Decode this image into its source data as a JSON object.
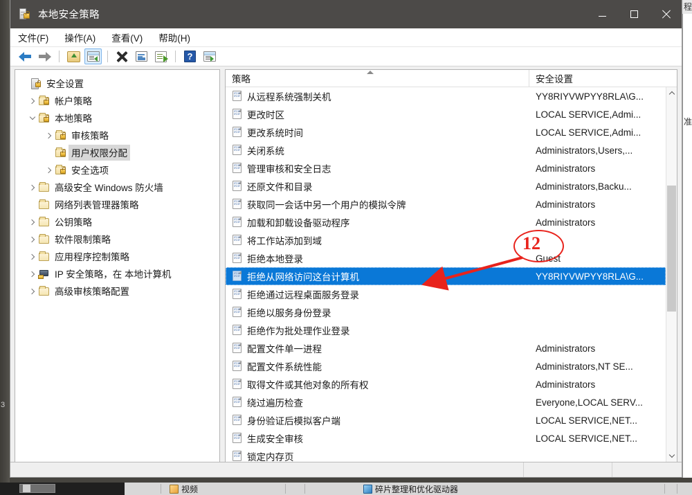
{
  "window": {
    "title": "本地安全策略",
    "icon": "security-policy-icon",
    "minimize_label": "最小化",
    "maximize_label": "最大化",
    "close_label": "关闭"
  },
  "menu": {
    "items": [
      {
        "label": "文件(F)"
      },
      {
        "label": "操作(A)"
      },
      {
        "label": "查看(V)"
      },
      {
        "label": "帮助(H)"
      }
    ]
  },
  "toolbar": {
    "buttons": [
      {
        "name": "back-arrow-icon",
        "label": "后退"
      },
      {
        "name": "forward-arrow-icon",
        "label": "前进"
      },
      {
        "name": "up-folder-icon",
        "label": "上一级"
      },
      {
        "name": "show-tree-icon",
        "label": "显示/隐藏控制台树"
      },
      {
        "name": "delete-icon",
        "label": "删除"
      },
      {
        "name": "properties-icon",
        "label": "属性"
      },
      {
        "name": "export-list-icon",
        "label": "导出列表"
      },
      {
        "name": "help-icon",
        "label": "?"
      },
      {
        "name": "window-icon",
        "label": "窗口"
      }
    ],
    "help_glyph": "?"
  },
  "tree": {
    "nodes": [
      {
        "label": "安全设置",
        "depth": 0,
        "expander": "none",
        "icon": "server-lock-icon",
        "selected": false
      },
      {
        "label": "帐户策略",
        "depth": 1,
        "expander": "closed",
        "icon": "folder-lock-icon",
        "selected": false
      },
      {
        "label": "本地策略",
        "depth": 1,
        "expander": "open",
        "icon": "folder-lock-icon",
        "selected": false
      },
      {
        "label": "审核策略",
        "depth": 2,
        "expander": "closed",
        "icon": "folder-lock-icon",
        "selected": false
      },
      {
        "label": "用户权限分配",
        "depth": 2,
        "expander": "none",
        "icon": "folder-lock-icon",
        "selected": true
      },
      {
        "label": "安全选项",
        "depth": 2,
        "expander": "closed",
        "icon": "folder-lock-icon",
        "selected": false
      },
      {
        "label": "高级安全 Windows 防火墙",
        "depth": 1,
        "expander": "closed",
        "icon": "folder-icon",
        "selected": false
      },
      {
        "label": "网络列表管理器策略",
        "depth": 1,
        "expander": "none",
        "icon": "folder-icon",
        "selected": false
      },
      {
        "label": "公钥策略",
        "depth": 1,
        "expander": "closed",
        "icon": "folder-icon",
        "selected": false
      },
      {
        "label": "软件限制策略",
        "depth": 1,
        "expander": "closed",
        "icon": "folder-icon",
        "selected": false
      },
      {
        "label": "应用程序控制策略",
        "depth": 1,
        "expander": "closed",
        "icon": "folder-icon",
        "selected": false
      },
      {
        "label": "IP 安全策略，在 本地计算机",
        "depth": 1,
        "expander": "closed",
        "icon": "network-policy-icon",
        "selected": false
      },
      {
        "label": "高级审核策略配置",
        "depth": 1,
        "expander": "closed",
        "icon": "folder-icon",
        "selected": false
      }
    ]
  },
  "list": {
    "columns": [
      {
        "label": "策略",
        "sort": "asc"
      },
      {
        "label": "安全设置",
        "sort": "none"
      }
    ],
    "rows": [
      {
        "policy": "从远程系统强制关机",
        "setting": "YY8RIYVWPYY8RLA\\G...",
        "selected": false
      },
      {
        "policy": "更改时区",
        "setting": "LOCAL SERVICE,Admi...",
        "selected": false
      },
      {
        "policy": "更改系统时间",
        "setting": "LOCAL SERVICE,Admi...",
        "selected": false
      },
      {
        "policy": "关闭系统",
        "setting": "Administrators,Users,...",
        "selected": false
      },
      {
        "policy": "管理审核和安全日志",
        "setting": "Administrators",
        "selected": false
      },
      {
        "policy": "还原文件和目录",
        "setting": "Administrators,Backu...",
        "selected": false
      },
      {
        "policy": "获取同一会话中另一个用户的模拟令牌",
        "setting": "Administrators",
        "selected": false
      },
      {
        "policy": "加载和卸载设备驱动程序",
        "setting": "Administrators",
        "selected": false
      },
      {
        "policy": "将工作站添加到域",
        "setting": "",
        "selected": false
      },
      {
        "policy": "拒绝本地登录",
        "setting": "Guest",
        "selected": false
      },
      {
        "policy": "拒绝从网络访问这台计算机",
        "setting": "YY8RIYVWPYY8RLA\\G...",
        "selected": true
      },
      {
        "policy": "拒绝通过远程桌面服务登录",
        "setting": "",
        "selected": false
      },
      {
        "policy": "拒绝以服务身份登录",
        "setting": "",
        "selected": false
      },
      {
        "policy": "拒绝作为批处理作业登录",
        "setting": "",
        "selected": false
      },
      {
        "policy": "配置文件单一进程",
        "setting": "Administrators",
        "selected": false
      },
      {
        "policy": "配置文件系统性能",
        "setting": "Administrators,NT SE...",
        "selected": false
      },
      {
        "policy": "取得文件或其他对象的所有权",
        "setting": "Administrators",
        "selected": false
      },
      {
        "policy": "绕过遍历检查",
        "setting": "Everyone,LOCAL SERV...",
        "selected": false
      },
      {
        "policy": "身份验证后模拟客户端",
        "setting": "LOCAL SERVICE,NET...",
        "selected": false
      },
      {
        "policy": "生成安全审核",
        "setting": "LOCAL SERVICE,NET...",
        "selected": false
      },
      {
        "policy": "锁定内存页",
        "setting": "",
        "selected": false
      }
    ]
  },
  "annotation": {
    "number": "12",
    "color": "#e8231c",
    "shape": "ellipse-with-arrow",
    "points_to": "拒绝从网络访问这台计算机"
  },
  "background": {
    "right_window_glyph": "准",
    "left_desktop_glyph": "3",
    "taskbar_items": [
      {
        "label": "视频",
        "icon": "folder-icon"
      },
      {
        "label": "碎片整理和优化驱动器",
        "icon": "defrag-icon"
      }
    ]
  },
  "statusbar": {
    "left_text": "",
    "middle_text": "",
    "right_text": ""
  }
}
